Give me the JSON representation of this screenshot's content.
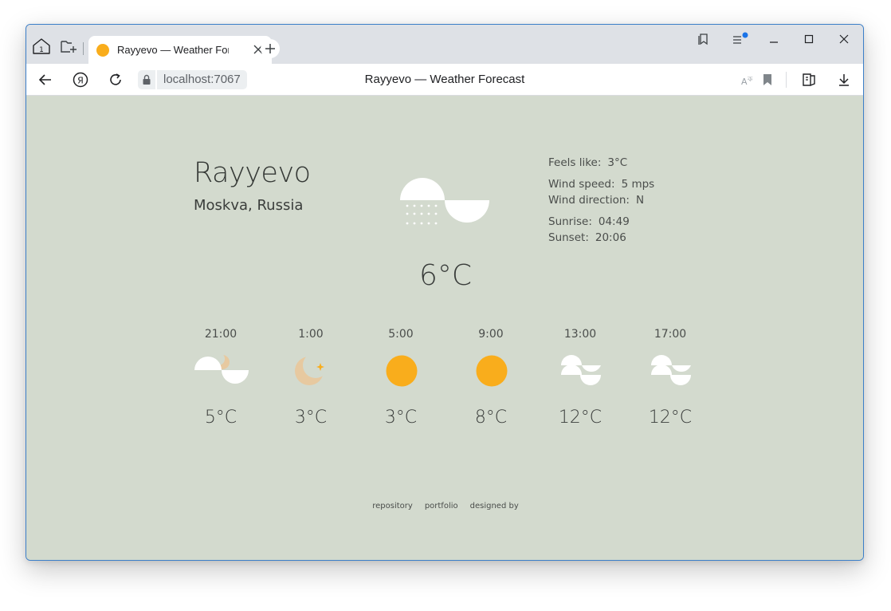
{
  "browser": {
    "tab_title": "Rayyevo — Weather For",
    "url": "localhost:7067",
    "page_title": "Rayyevo — Weather Forecast",
    "tab_counter": "1"
  },
  "colors": {
    "page_background": "#d3dace",
    "sun": "#f9ad1c",
    "moon": "#e7c9a0",
    "cloud": "#ffffff",
    "text": "#3a3d3b"
  },
  "location": {
    "city": "Rayyevo",
    "region": "Moskva, Russia"
  },
  "current": {
    "icon": "cloud-rain-icon",
    "temperature": "6°C",
    "feels_like_label": "Feels like:",
    "feels_like_value": "3°C",
    "wind_speed_label": "Wind speed:",
    "wind_speed_value": "5 mps",
    "wind_direction_label": "Wind direction:",
    "wind_direction_value": "N",
    "sunrise_label": "Sunrise:",
    "sunrise_value": "04:49",
    "sunset_label": "Sunset:",
    "sunset_value": "20:06"
  },
  "forecast": [
    {
      "time": "21:00",
      "icon": "moon-cloud-icon",
      "temp": "5°C"
    },
    {
      "time": "1:00",
      "icon": "moon-star-icon",
      "temp": "3°C"
    },
    {
      "time": "5:00",
      "icon": "sun-icon",
      "temp": "3°C"
    },
    {
      "time": "9:00",
      "icon": "sun-icon",
      "temp": "8°C"
    },
    {
      "time": "13:00",
      "icon": "clouds-icon",
      "temp": "12°C"
    },
    {
      "time": "17:00",
      "icon": "clouds-icon",
      "temp": "12°C"
    }
  ],
  "footer": {
    "repository": "repository",
    "portfolio": "portfolio",
    "designed_by": "designed by"
  }
}
